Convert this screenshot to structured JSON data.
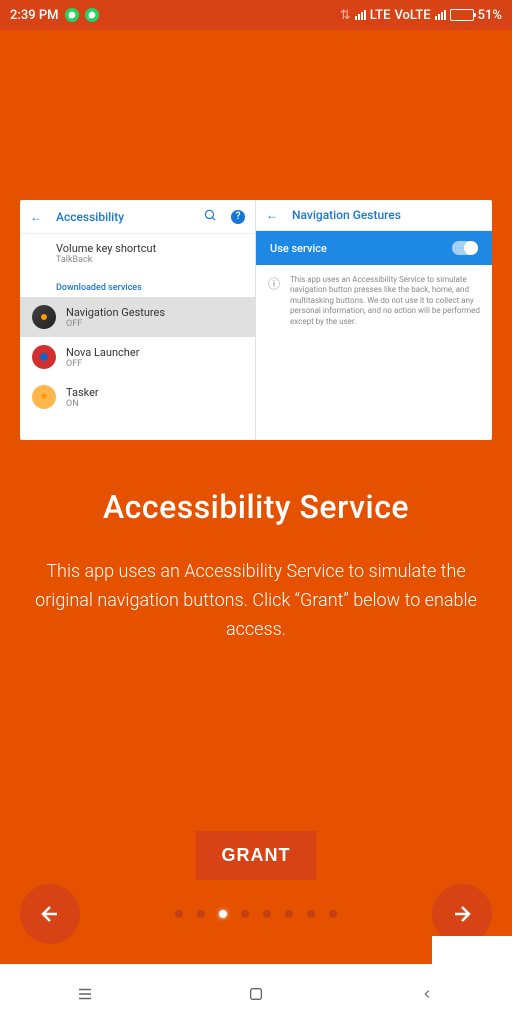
{
  "status": {
    "time": "2:39 PM",
    "network1": "LTE",
    "network2": "VoLTE",
    "battery": "51%"
  },
  "card": {
    "left_title": "Accessibility",
    "right_title": "Navigation Gestures",
    "volume_item": {
      "title": "Volume key shortcut",
      "sub": "TalkBack"
    },
    "downloaded_header": "Downloaded services",
    "items": [
      {
        "title": "Navigation Gestures",
        "sub": "OFF"
      },
      {
        "title": "Nova Launcher",
        "sub": "OFF"
      },
      {
        "title": "Tasker",
        "sub": "ON"
      }
    ],
    "use_service": "Use service",
    "info_text": "This app uses an Accessibility Service to simulate navigation button presses like the back, home, and multitasking buttons. We do not use it to collect any personal information, and no action will be performed except by the user."
  },
  "onboarding": {
    "title": "Accessibility Service",
    "description": "This app uses an Accessibility Service to simulate the original navigation buttons. Click “Grant” below to enable access.",
    "grant_button": "GRANT"
  }
}
